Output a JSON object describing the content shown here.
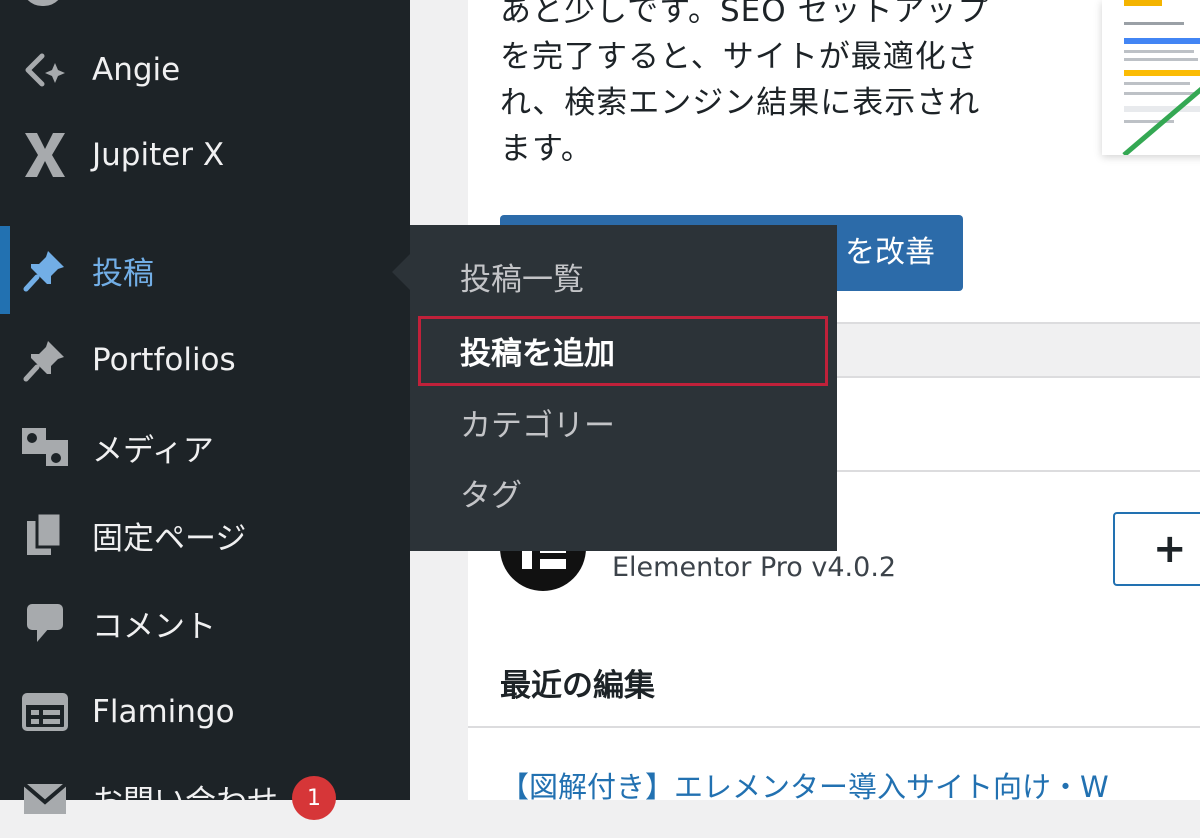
{
  "sidebar": {
    "items": [
      {
        "label": "Angie",
        "icon": "angie-icon"
      },
      {
        "label": "Jupiter X",
        "icon": "jupiter-x-icon"
      },
      {
        "label": "投稿",
        "icon": "pin-icon",
        "active": true
      },
      {
        "label": "Portfolios",
        "icon": "pin-icon"
      },
      {
        "label": "メディア",
        "icon": "media-icon"
      },
      {
        "label": "固定ページ",
        "icon": "pages-icon"
      },
      {
        "label": "コメント",
        "icon": "comment-icon"
      },
      {
        "label": "Flamingo",
        "icon": "flamingo-icon"
      },
      {
        "label": "お問い合わせ",
        "icon": "mail-icon",
        "badge": "1"
      }
    ]
  },
  "submenu": {
    "items": [
      "投稿一覧",
      "投稿を追加",
      "カテゴリー",
      "タグ"
    ],
    "highlighted": "投稿を追加"
  },
  "main": {
    "promo_lines": [
      "あと少しです。SEO セットアップ",
      "を完了すると、サイトが最適化さ",
      "れ、検索エンジン結果に表示され",
      "ます。"
    ],
    "promo_button": "を改善",
    "plugin_version": "Elementor Pro v4.0.2",
    "plus_label": "+",
    "recent_title": "最近の編集",
    "recent_link": "【図解付き】エレメンター導入サイト向け・W"
  },
  "colors": {
    "sidebar_bg": "#1d2327",
    "flyout_bg": "#2c3338",
    "accent": "#2271b1",
    "highlight_border": "#c0213a",
    "badge": "#d63638"
  }
}
